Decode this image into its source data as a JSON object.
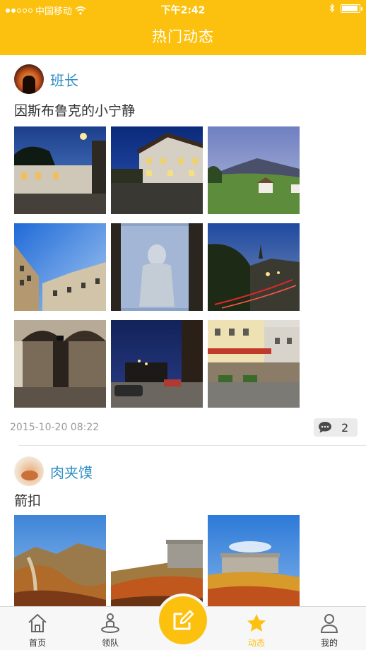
{
  "status_bar": {
    "carrier": "中国移动",
    "time": "下午2:42",
    "signal_dots": 5,
    "signal_filled": 2,
    "battery_level": 0.9
  },
  "header": {
    "title": "热门动态"
  },
  "colors": {
    "accent": "#fcc10e",
    "name_link": "#2f8ec6"
  },
  "posts": [
    {
      "author": "班长",
      "text": "因斯布鲁克的小宁静",
      "timestamp": "2015-10-20 08:22",
      "comment_count": "2",
      "comment_icon": "comment-bubble-icon"
    },
    {
      "author": "肉夹馍",
      "text": "箭扣"
    }
  ],
  "tabbar": {
    "items": [
      {
        "label": "首页",
        "icon": "home-icon"
      },
      {
        "label": "领队",
        "icon": "leader-icon"
      },
      {
        "label": "",
        "icon": "compose-icon"
      },
      {
        "label": "动态",
        "icon": "star-icon"
      },
      {
        "label": "我的",
        "icon": "profile-icon"
      }
    ]
  }
}
